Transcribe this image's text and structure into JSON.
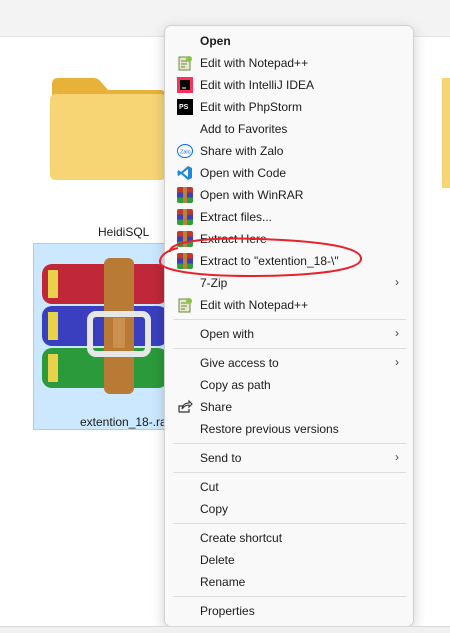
{
  "explorer": {
    "items": [
      {
        "name": "HeidiSQL"
      },
      {
        "name": "extention_18-.ra"
      }
    ]
  },
  "menu": {
    "items": [
      {
        "label": "Open",
        "icon": "none",
        "bold": true
      },
      {
        "label": "Edit with Notepad++",
        "icon": "notepadpp-icon"
      },
      {
        "label": "Edit with IntelliJ IDEA",
        "icon": "intellij-icon"
      },
      {
        "label": "Edit with PhpStorm",
        "icon": "phpstorm-icon"
      },
      {
        "label": "Add to Favorites",
        "icon": "none"
      },
      {
        "label": "Share with Zalo",
        "icon": "zalo-icon"
      },
      {
        "label": "Open with Code",
        "icon": "vscode-icon"
      },
      {
        "label": "Open with WinRAR",
        "icon": "winrar-icon"
      },
      {
        "label": "Extract files...",
        "icon": "winrar-icon"
      },
      {
        "label": "Extract Here",
        "icon": "winrar-icon"
      },
      {
        "label": "Extract to \"extention_18-\\\"",
        "icon": "winrar-icon",
        "highlighted": true
      },
      {
        "label": "7-Zip",
        "icon": "none",
        "submenu": true
      },
      {
        "label": "Edit with Notepad++",
        "icon": "notepadpp-icon"
      },
      {
        "label": "Open with",
        "icon": "none",
        "submenu": true
      },
      {
        "label": "Give access to",
        "icon": "none",
        "submenu": true
      },
      {
        "label": "Copy as path",
        "icon": "none"
      },
      {
        "label": "Share",
        "icon": "share-icon"
      },
      {
        "label": "Restore previous versions",
        "icon": "none"
      },
      {
        "label": "Send to",
        "icon": "none",
        "submenu": true
      },
      {
        "label": "Cut",
        "icon": "none"
      },
      {
        "label": "Copy",
        "icon": "none"
      },
      {
        "label": "Create shortcut",
        "icon": "none"
      },
      {
        "label": "Delete",
        "icon": "none"
      },
      {
        "label": "Rename",
        "icon": "none"
      },
      {
        "label": "Properties",
        "icon": "none"
      }
    ],
    "chevron": "›",
    "annotation_color": "#e8222b"
  }
}
